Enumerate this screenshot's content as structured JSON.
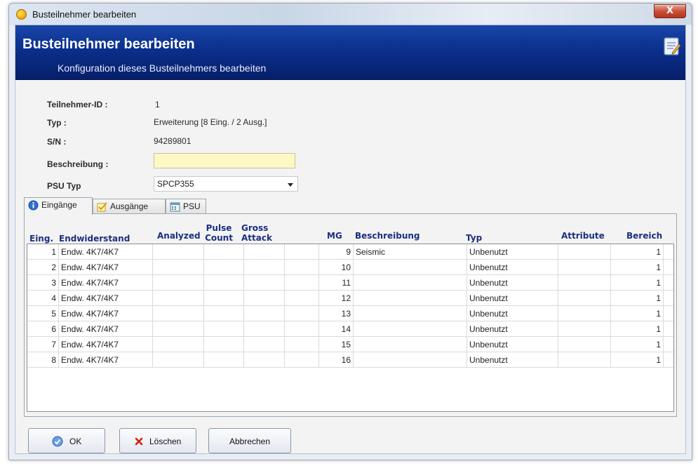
{
  "window": {
    "title": "Busteilnehmer bearbeiten",
    "close_glyph": "X"
  },
  "header": {
    "title": "Busteilnehmer bearbeiten",
    "subtitle": "Konfiguration dieses Busteilnehmers bearbeiten",
    "icon": "edit-document-icon"
  },
  "form": {
    "id_label": "Teilnehmer-ID :",
    "id_value": "1",
    "typ_label": "Typ :",
    "typ_value": "Erweiterung [8 Eing. / 2 Ausg.]",
    "sn_label": "S/N :",
    "sn_value": "94289801",
    "desc_label": "Beschreibung :",
    "desc_value": "",
    "psu_label": "PSU Typ",
    "psu_value": "SPCP355"
  },
  "tabs": [
    {
      "label": "Eingänge",
      "icon": "info-icon"
    },
    {
      "label": "Ausgänge",
      "icon": "checkbox-icon"
    },
    {
      "label": "PSU",
      "icon": "calendar-icon"
    }
  ],
  "table": {
    "headers": {
      "eing": "Eing.",
      "endw": "Endwiderstand",
      "analyzed": "Analyzed",
      "pulse1": "Pulse",
      "pulse2": "Count",
      "gross1": "Gross",
      "gross2": "Attack",
      "mg": "MG",
      "besch": "Beschreibung",
      "typ": "Typ",
      "attr": "Attribute",
      "bereich": "Bereich"
    },
    "rows": [
      {
        "eing": "1",
        "endw": "Endw. 4K7/4K7",
        "mg": "9",
        "besch": "Seismic",
        "typ": "Unbenutzt",
        "bereich": "1"
      },
      {
        "eing": "2",
        "endw": "Endw. 4K7/4K7",
        "mg": "10",
        "besch": "",
        "typ": "Unbenutzt",
        "bereich": "1"
      },
      {
        "eing": "3",
        "endw": "Endw. 4K7/4K7",
        "mg": "11",
        "besch": "",
        "typ": "Unbenutzt",
        "bereich": "1"
      },
      {
        "eing": "4",
        "endw": "Endw. 4K7/4K7",
        "mg": "12",
        "besch": "",
        "typ": "Unbenutzt",
        "bereich": "1"
      },
      {
        "eing": "5",
        "endw": "Endw. 4K7/4K7",
        "mg": "13",
        "besch": "",
        "typ": "Unbenutzt",
        "bereich": "1"
      },
      {
        "eing": "6",
        "endw": "Endw. 4K7/4K7",
        "mg": "14",
        "besch": "",
        "typ": "Unbenutzt",
        "bereich": "1"
      },
      {
        "eing": "7",
        "endw": "Endw. 4K7/4K7",
        "mg": "15",
        "besch": "",
        "typ": "Unbenutzt",
        "bereich": "1"
      },
      {
        "eing": "8",
        "endw": "Endw. 4K7/4K7",
        "mg": "16",
        "besch": "",
        "typ": "Unbenutzt",
        "bereich": "1"
      }
    ]
  },
  "buttons": {
    "ok": {
      "label": "OK",
      "icon": "ok-check-icon"
    },
    "delete": {
      "label": "Löschen",
      "icon": "red-x-icon"
    },
    "cancel": {
      "label": "Abbrechen"
    }
  },
  "colors": {
    "header_blue": "#0b2f8c",
    "column_header_text": "#1b2f80",
    "description_field": "#fdf8c4"
  }
}
